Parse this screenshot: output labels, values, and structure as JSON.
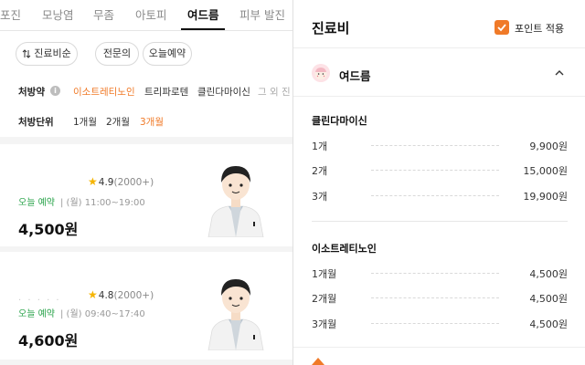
{
  "left": {
    "tabs": [
      {
        "label": "포진"
      },
      {
        "label": "모낭염"
      },
      {
        "label": "무좀"
      },
      {
        "label": "아토피"
      },
      {
        "label": "여드름"
      },
      {
        "label": "피부 발진"
      }
    ],
    "chips": {
      "sort_label": "진료비순",
      "specialist_label": "전문의",
      "today_label": "오늘예약"
    },
    "prescription": {
      "label": "처방약",
      "info_icon": "i",
      "items": [
        "이소트레티노인",
        "트리파로텐",
        "클린다마이신",
        "그 외 진"
      ]
    },
    "unit": {
      "label": "처방단위",
      "items": [
        "1개월",
        "2개월",
        "3개월"
      ]
    },
    "cards": [
      {
        "rating": "4.9",
        "count": "(2000+)",
        "open_label": "오늘 예약",
        "hours": "|  (월) 11:00~19:00",
        "price": "4,500원"
      },
      {
        "rating": "4.8",
        "count": "(2000+)",
        "open_label": "오늘 예약",
        "hours": "|  (월) 09:40~17:40",
        "price": "4,600원"
      }
    ]
  },
  "right": {
    "title": "진료비",
    "point_label": "포인트 적용",
    "category": "여드름",
    "sections": [
      {
        "name": "클린다마이신",
        "rows": [
          {
            "qty": "1개",
            "price": "9,900원"
          },
          {
            "qty": "2개",
            "price": "15,000원"
          },
          {
            "qty": "3개",
            "price": "19,900원"
          }
        ]
      },
      {
        "name": "이소트레티노인",
        "rows": [
          {
            "qty": "1개월",
            "price": "4,500원"
          },
          {
            "qty": "2개월",
            "price": "4,500원"
          },
          {
            "qty": "3개월",
            "price": "4,500원"
          }
        ]
      }
    ]
  },
  "colors": {
    "accent": "#f07a28",
    "open_green": "#29a34a",
    "star": "#f5b400"
  },
  "icons": {
    "sort": "sort-arrows-icon",
    "info": "info-icon",
    "star": "star-icon",
    "checkbox": "checkbox-checked-icon",
    "category": "acne-face-icon",
    "chevron": "chevron-up-icon"
  }
}
